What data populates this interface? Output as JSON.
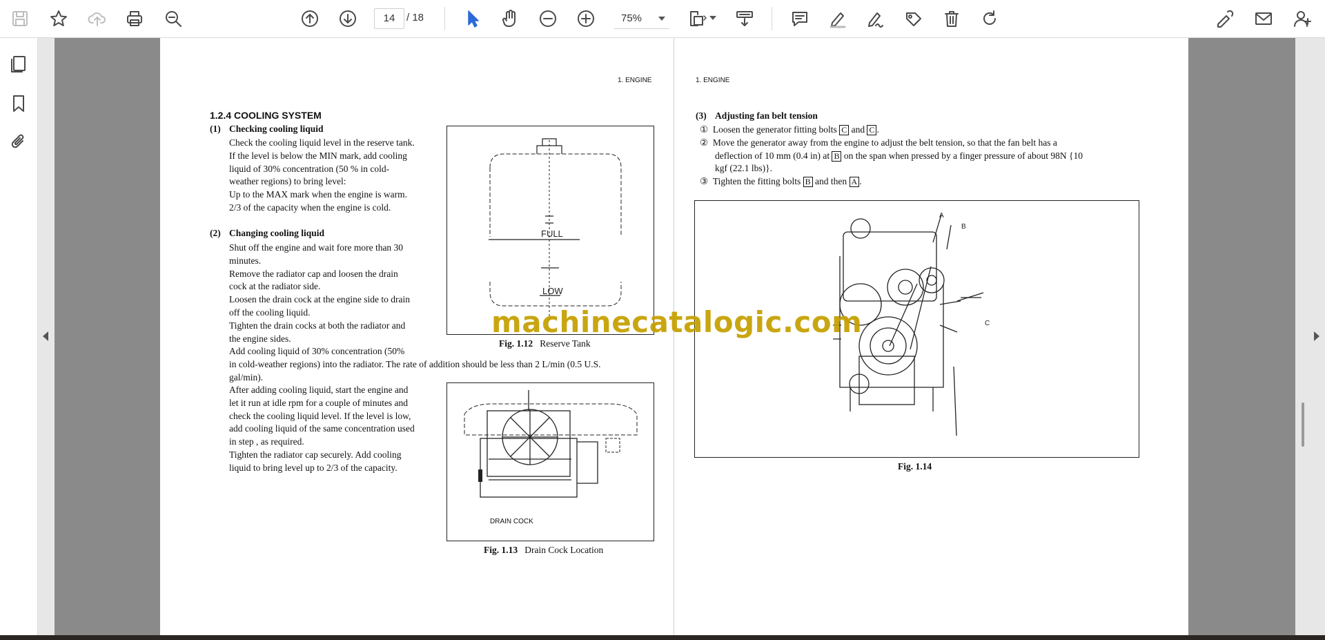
{
  "toolbar": {
    "current_page": "14",
    "total_pages": "/ 18",
    "zoom": "75%"
  },
  "doc": {
    "left_header": "1.  ENGINE",
    "right_header": "1.  ENGINE",
    "section_title": "1.2.4  COOLING SYSTEM",
    "s1_num": "(1)",
    "s1_title": "Checking cooling liquid",
    "s1_lines": [
      "Check the cooling liquid level in the reserve tank.",
      "If the level is below the MIN mark, add cooling",
      "liquid of 30% concentration (50 % in cold-",
      "weather regions) to bring level:",
      "Up to the MAX mark when the engine is warm.",
      "2/3 of the capacity when the engine is cold."
    ],
    "s2_num": "(2)",
    "s2_title": "Changing cooling liquid",
    "s2_lines": [
      "Shut off the engine and wait fore more than 30",
      "minutes.",
      "Remove the radiator cap and loosen the drain",
      "cock at the radiator side.",
      "Loosen the drain cock at the engine side to drain",
      "off the cooling liquid.",
      "Tighten the drain cocks at both the radiator and",
      "the engine sides.",
      "Add cooling liquid of 30% concentration (50%"
    ],
    "s2_wide_lines": [
      "in cold-weather regions) into the radiator.  The rate of addition should be less than 2 L/min (0.5 U.S.",
      "gal/min)."
    ],
    "s2_tail_lines": [
      "After adding cooling liquid, start the engine and",
      "let it run at idle rpm for a couple of minutes and",
      "check the cooling liquid level.  If the level is low,",
      "add cooling liquid of the same concentration used",
      "in step , as required.",
      "Tighten the radiator cap securely.  Add cooling",
      "liquid to bring level up to 2/3 of the capacity."
    ],
    "fig12_num": "Fig. 1.12",
    "fig12_title": "Reserve Tank",
    "fig12_full": "FULL",
    "fig12_low": "LOW",
    "fig13_num": "Fig. 1.13",
    "fig13_title": "Drain Cock Location",
    "fig13_label": "DRAIN COCK",
    "s3_num": "(3)",
    "s3_title": "Adjusting fan belt tension",
    "step1_mark": "①",
    "step1_text_a": "Loosen the generator fitting bolts",
    "step1_box1": "C",
    "step1_and": "and",
    "step1_box2": "C",
    "step1_end": ".",
    "step2_mark": "②",
    "step2_line1": "Move the generator away from the engine to adjust the belt tension, so that the fan belt has a",
    "step2_line2a": "deflection of 10 mm (0.4 in) at",
    "step2_box": "B",
    "step2_line2b": "on the span when pressed by a finger pressure of about 98N {10",
    "step2_line3": "kgf (22.1 lbs)}.",
    "step3_mark": "③",
    "step3_text_a": "Tighten the fitting bolts",
    "step3_box1": "B",
    "step3_and": "and then",
    "step3_box2": "A",
    "step3_end": ".",
    "fig14_num": "Fig. 1.14",
    "fig14_callouts": [
      "A",
      "B",
      "C"
    ]
  },
  "watermark": "machinecatalogic.com"
}
